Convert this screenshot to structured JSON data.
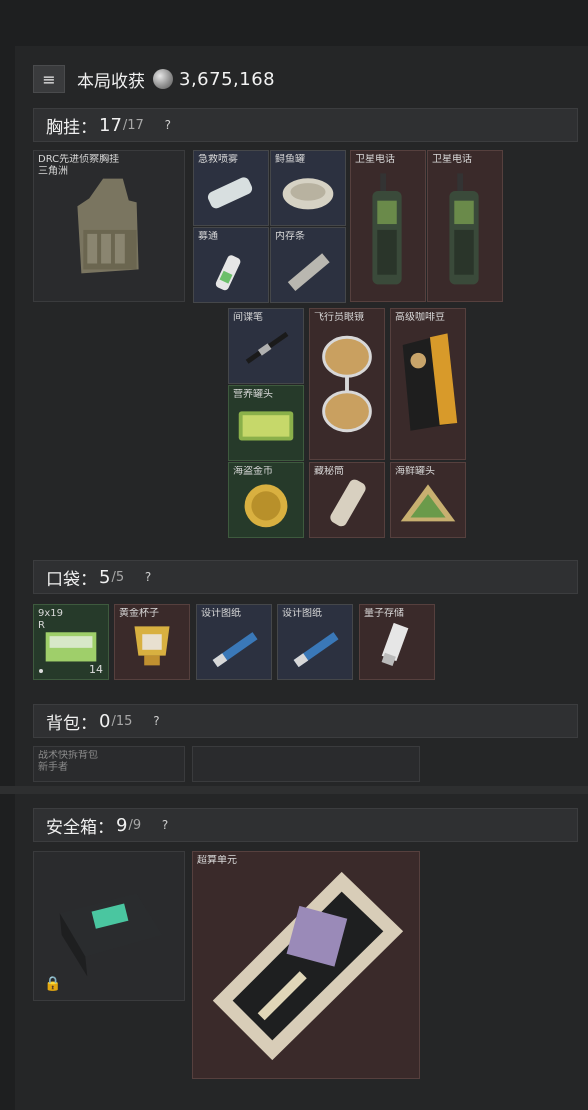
{
  "header": {
    "title": "本局收获",
    "value": "3,675,168",
    "menu_icon": "list-icon",
    "coin_icon": "coin-icon"
  },
  "sections": {
    "chest": {
      "label": "胸挂：",
      "count": "17",
      "max": "/17",
      "help": "?"
    },
    "pocket": {
      "label": "口袋：",
      "count": "5",
      "max": "/5",
      "help": "?"
    },
    "backpack": {
      "label": "背包：",
      "count": "0",
      "max": "/15",
      "help": "?"
    },
    "safe": {
      "label": "安全箱：",
      "count": "9",
      "max": "/9",
      "help": "?"
    }
  },
  "chest_items": {
    "rig": {
      "name_line1": "DRC先进侦察胸挂",
      "name_line2": "三角洲"
    },
    "first_aid": "急救喷雾",
    "fish_can": "鲟鱼罐",
    "drug": "募通",
    "ram": "内存条",
    "phone1": "卫星电话",
    "phone2": "卫星电话",
    "spy_pen": "间谍笔",
    "aviator": "飞行员眼镜",
    "coffee": "高级咖啡豆",
    "tin_can": "营养罐头",
    "coin": "海盗金币",
    "scroll": "藏秘筒",
    "sea_can": "海鲜罐头"
  },
  "pocket_items": {
    "ammo": {
      "name_line1": "9x19",
      "name_line2": "R",
      "qty": "14"
    },
    "cup": "黄金杯子",
    "blueprint1": "设计图纸",
    "blueprint2": "设计图纸",
    "quantum": "量子存储"
  },
  "backpack_items": {
    "bag": {
      "name_line1": "战术快拆背包",
      "name_line2": "新手者"
    }
  },
  "safe_items": {
    "case_lock_icon": "lock-icon",
    "super": "超算单元"
  },
  "colors": {
    "panel": "#252627",
    "slot_blue": "#2c3140",
    "slot_red": "#3a2a2a",
    "slot_green": "#263a2a"
  }
}
